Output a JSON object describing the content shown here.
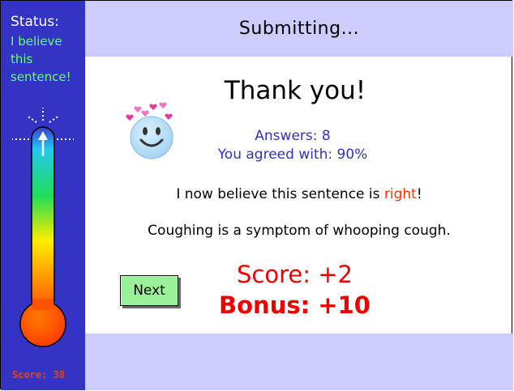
{
  "sidebar": {
    "status_title": "Status:",
    "status_text": "I believe this sentence!",
    "score_text": "Score: 38",
    "thermometer_level": 0.95,
    "thermometer_icon": "thermometer-icon"
  },
  "header": {
    "title": "Submitting..."
  },
  "main": {
    "thank_you": "Thank you!",
    "smiley_icon": "smiley-with-hearts-icon",
    "answers": "Answers: 8",
    "agreed": "You agreed with: 90%",
    "belief_prefix": "I now believe this sentence is ",
    "belief_word": "right",
    "belief_suffix": "!",
    "sentence": "Coughing is a symptom of whooping cough.",
    "next_label": "Next",
    "score": "Score: +2",
    "bonus": "Bonus: +10"
  },
  "colors": {
    "sidebar_bg": "#3434c4",
    "header_bg": "#ccccff",
    "status_text": "#66ff66",
    "score_red": "#ee0000",
    "next_button": "#99f199",
    "answers_blue": "#3333bb",
    "belief_word": "#ff3300"
  }
}
